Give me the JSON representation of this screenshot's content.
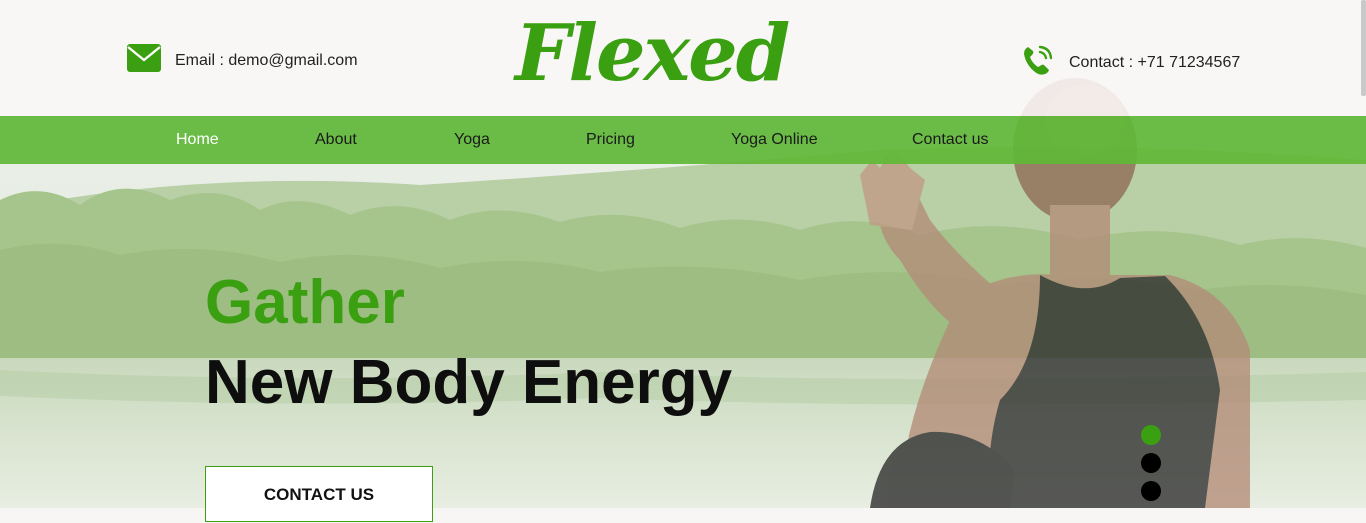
{
  "header": {
    "email_text": "Email : demo@gmail.com",
    "contact_text": "Contact : +71 71234567",
    "logo_text": "Flexed"
  },
  "nav": {
    "items": [
      {
        "label": "Home",
        "active": true
      },
      {
        "label": "About"
      },
      {
        "label": "Yoga"
      },
      {
        "label": "Pricing"
      },
      {
        "label": "Yoga Online"
      },
      {
        "label": "Contact us"
      }
    ]
  },
  "hero": {
    "line1": "Gather",
    "line2": "New Body Energy",
    "cta_label": "CONTACT US",
    "slider_dots": 3,
    "active_dot": 0
  },
  "colors": {
    "brand_green": "#3aa011",
    "nav_green": "#60b737",
    "text_dark": "#0e0e0e"
  },
  "icons": {
    "email": "envelope-icon",
    "contact": "phone-icon"
  }
}
